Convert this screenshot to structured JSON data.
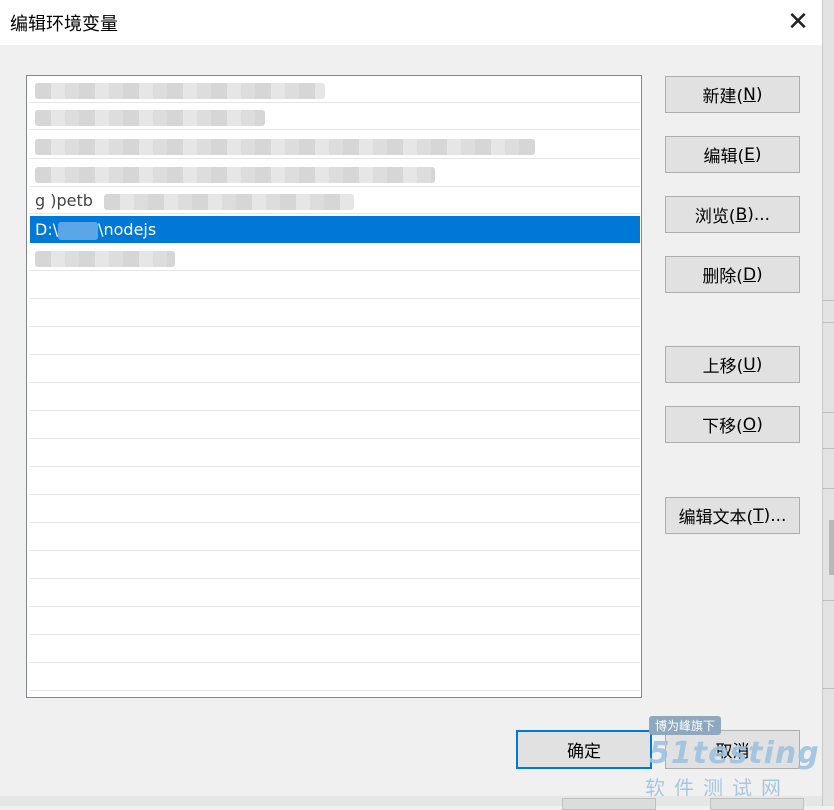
{
  "dialog": {
    "title": "编辑环境变量",
    "close_glyph": "✕",
    "close_icon": "close-icon"
  },
  "list": {
    "selected_text_prefix": "D:\\",
    "selected_text_suffix": "\\nodejs",
    "partial_text": "g            )petb"
  },
  "buttons": {
    "new": {
      "label": "新建(",
      "key": "N",
      "close": ")"
    },
    "edit": {
      "label": "编辑(",
      "key": "E",
      "close": ")"
    },
    "browse": {
      "label": "浏览(",
      "key": "B",
      "close": ")..."
    },
    "delete": {
      "label": "删除(",
      "key": "D",
      "close": ")"
    },
    "move_up": {
      "label": "上移(",
      "key": "U",
      "close": ")"
    },
    "move_down": {
      "label": "下移(",
      "key": "O",
      "close": ")"
    },
    "edit_text": {
      "label": "编辑文本(",
      "key": "T",
      "close": ")..."
    },
    "ok": {
      "label": "确定"
    },
    "cancel": {
      "label": "取消"
    }
  },
  "watermark": {
    "badge": "博为峰旗下",
    "logo": "51testing",
    "subtitle": "软件测试网"
  },
  "colors": {
    "selection": "#0078d7",
    "button_face": "#e1e1e1",
    "dialog_bg": "#f0f0f0"
  }
}
